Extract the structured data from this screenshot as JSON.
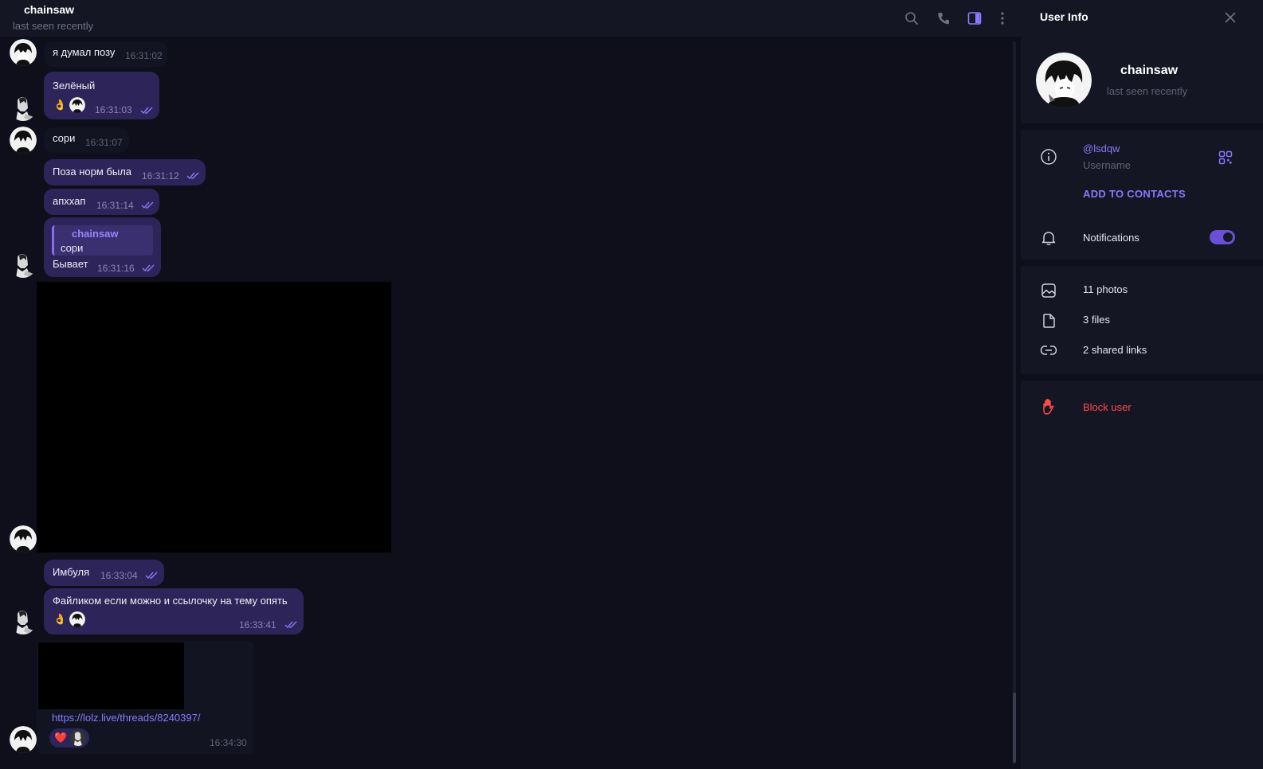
{
  "chat_header": {
    "title": "chainsaw",
    "status": "last seen recently"
  },
  "messages": [
    {
      "text": "я думал позу",
      "time": "16:31:02"
    },
    {
      "text": "Зелёный",
      "time": "16:31:03",
      "reaction_emoji": "👌"
    },
    {
      "text": "сори",
      "time": "16:31:07"
    },
    {
      "text": "Поза норм была",
      "time": "16:31:12"
    },
    {
      "text": "апхха­п",
      "time": "16:31:14"
    },
    {
      "reply_name": "chainsaw",
      "reply_text": "сори",
      "text": "Бывает",
      "time": "16:31:16"
    },
    {
      "text": "Имбуля",
      "time": "16:33:04"
    },
    {
      "text": "Файликом если можно и ссылочку на тему опять",
      "time": "16:33:41",
      "reaction_emoji": "👌"
    },
    {
      "link": "https://lolz.live/threads/8240397/",
      "time": "16:34:30",
      "reaction_emoji": "❤️"
    }
  ],
  "sidebar": {
    "title": "User Info",
    "name": "chainsaw",
    "status": "last seen recently",
    "username": "@lsdqw",
    "username_label": "Username",
    "add_contact": "ADD TO CONTACTS",
    "notifications": "Notifications",
    "notifications_on": true,
    "photos": "11 photos",
    "files": "3 files",
    "links": "2 shared links",
    "block": "Block user"
  },
  "colors": {
    "accent": "#8b78ff",
    "outgoing_bubble": "#2d2459",
    "danger": "#ff4a4a"
  }
}
